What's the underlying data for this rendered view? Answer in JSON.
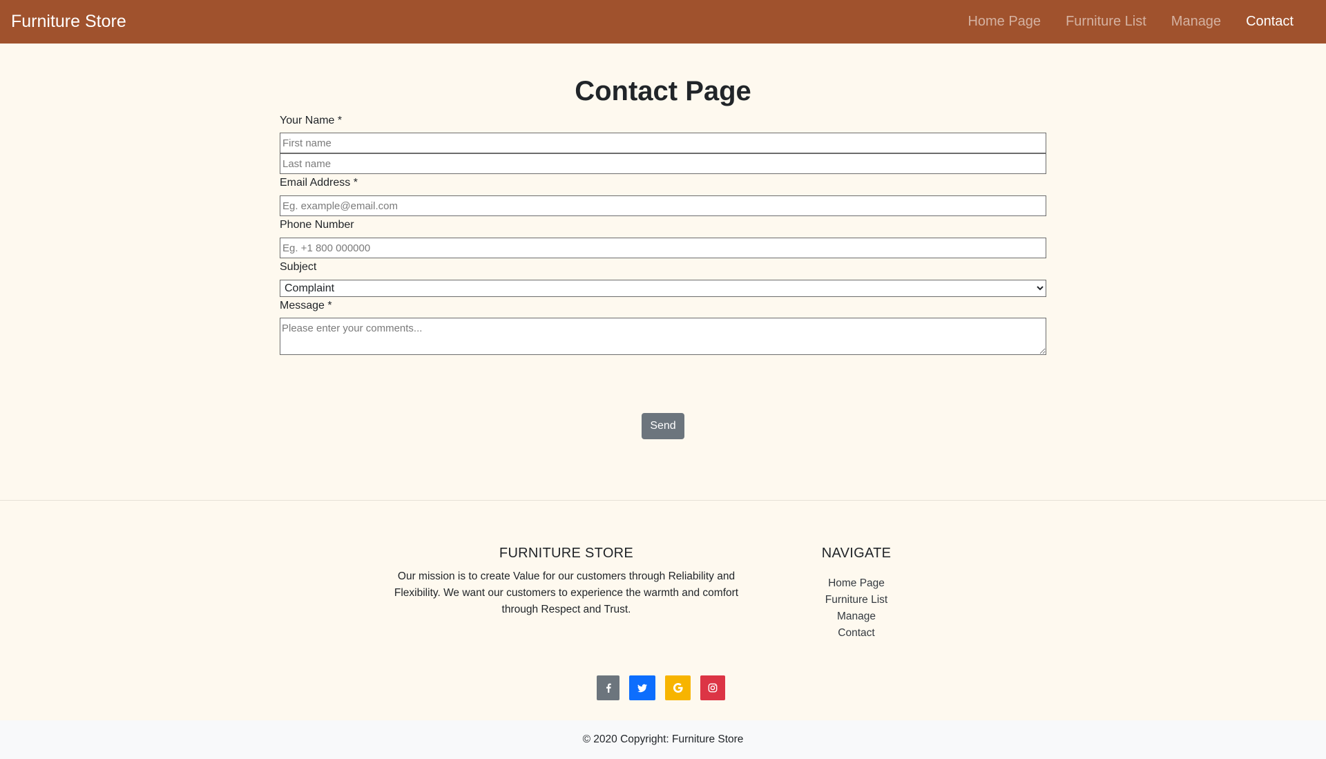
{
  "navbar": {
    "brand": "Furniture Store",
    "links": [
      {
        "label": "Home Page",
        "active": false
      },
      {
        "label": "Furniture List",
        "active": false
      },
      {
        "label": "Manage",
        "active": false
      },
      {
        "label": "Contact",
        "active": true
      }
    ],
    "color": "#a0522d"
  },
  "form": {
    "title": "Contact Page",
    "name_label": "Your Name *",
    "first_name_placeholder": "First name",
    "last_name_placeholder": "Last name",
    "email_label": "Email Address *",
    "email_placeholder": "Eg. example@email.com",
    "phone_label": "Phone Number",
    "phone_placeholder": "Eg. +1 800 000000",
    "subject_label": "Subject",
    "subject_selected": "Complaint",
    "message_label": "Message *",
    "message_placeholder": "Please enter your comments...",
    "send_label": "Send"
  },
  "footer": {
    "about_heading": "FURNITURE STORE",
    "about_text": "Our mission is to create Value for our customers through Reliability and Flexibility. We want our customers to experience the warmth and comfort through Respect and Trust.",
    "nav_heading": "NAVIGATE",
    "nav_links": [
      "Home Page",
      "Furniture List",
      "Manage",
      "Contact"
    ],
    "social": [
      {
        "icon": "facebook-icon",
        "color": "#6c757d"
      },
      {
        "icon": "twitter-icon",
        "color": "#0d6efd"
      },
      {
        "icon": "google-icon",
        "color": "#f7b400"
      },
      {
        "icon": "instagram-icon",
        "color": "#dc3545"
      }
    ],
    "copyright": "© 2020 Copyright: Furniture Store"
  }
}
